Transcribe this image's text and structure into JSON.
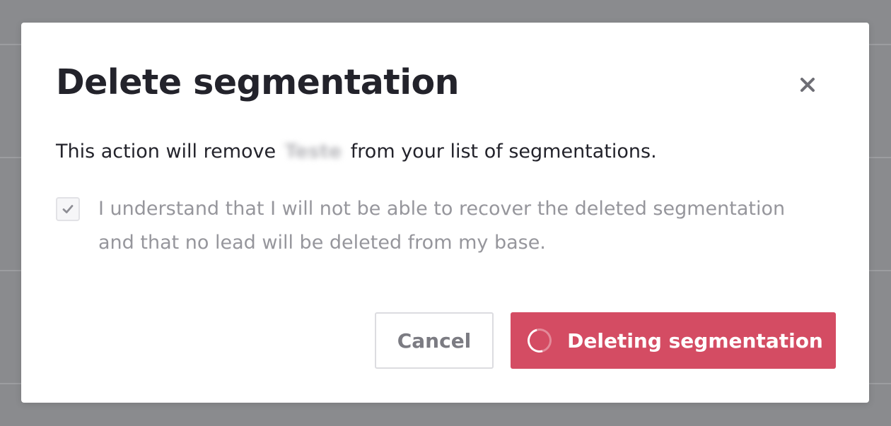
{
  "dialog": {
    "title": "Delete segmentation",
    "description_prefix": "This action will remove",
    "segmentation_name": "Teste",
    "description_suffix": "from your list of segmentations.",
    "confirm_checkbox": {
      "checked": true,
      "label": "I understand that I will not be able to recover the deleted segmentation and that no lead will be deleted from my base."
    },
    "cancel_label": "Cancel",
    "delete_label": "Deleting segmentation",
    "delete_loading": true,
    "close_icon": "close-icon"
  },
  "colors": {
    "danger": "#d44c63",
    "title": "#23232b",
    "muted": "#96969c",
    "overlay": "#8a8b8e"
  }
}
